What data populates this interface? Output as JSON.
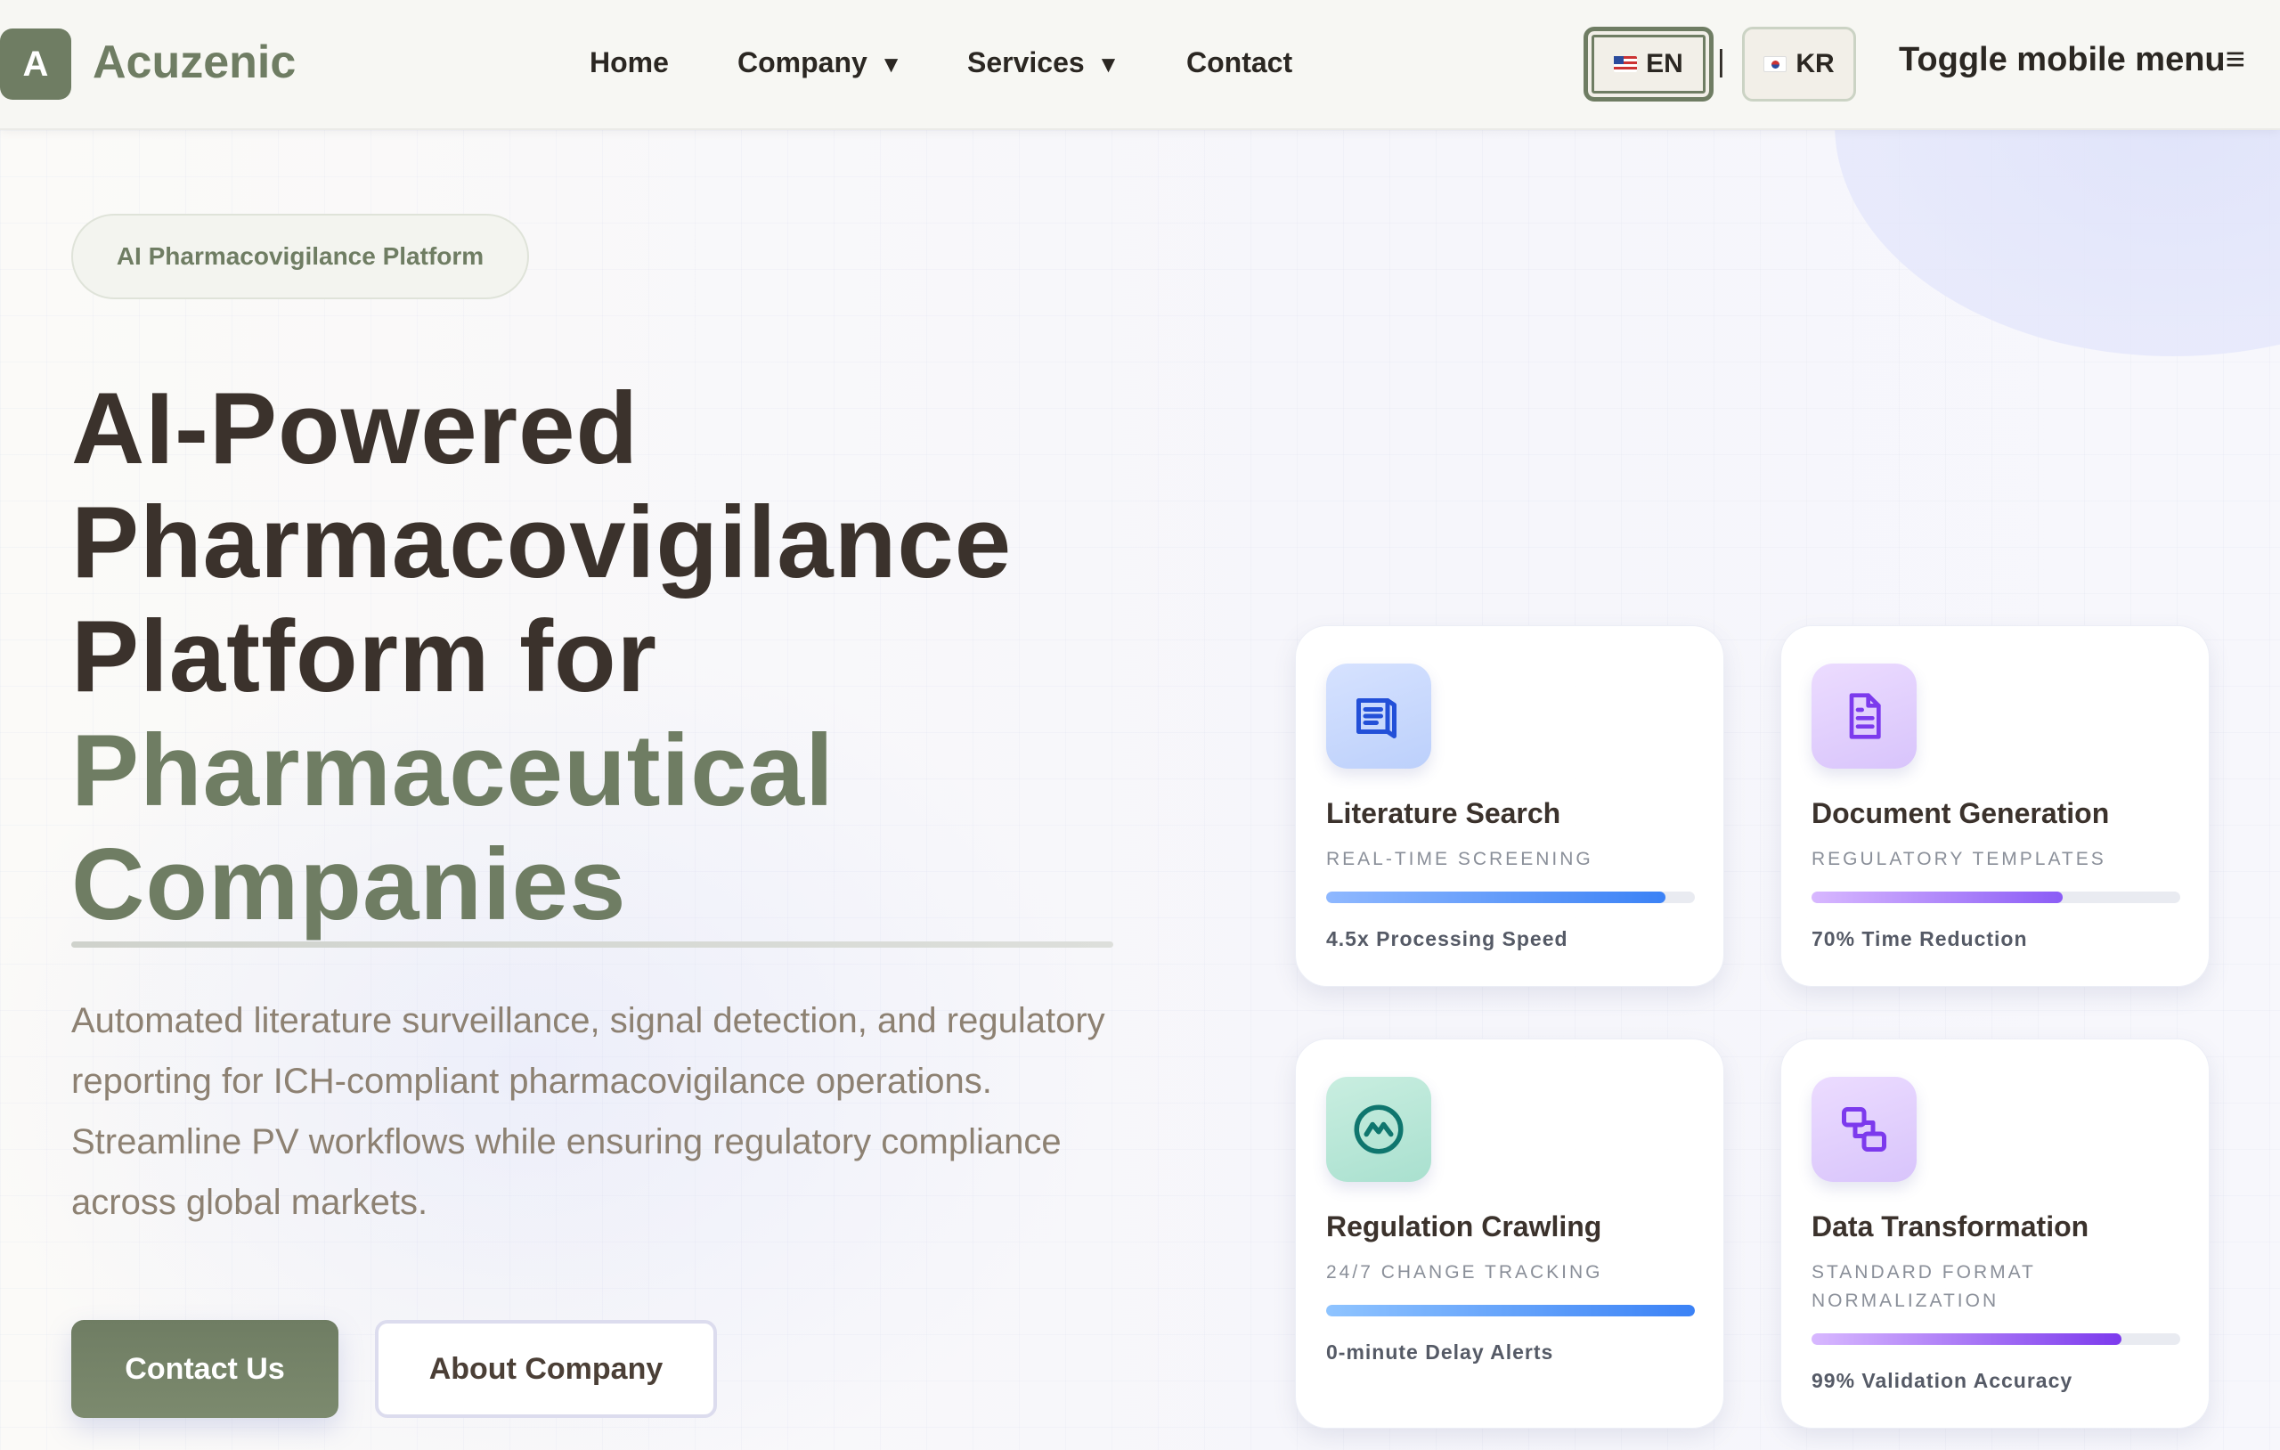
{
  "brand": {
    "logo_letter": "A",
    "name": "Acuzenic"
  },
  "nav": {
    "home": "Home",
    "company": "Company",
    "services": "Services",
    "contact": "Contact",
    "caret": "▼"
  },
  "language": {
    "en": "EN",
    "separator": "|",
    "kr": "KR"
  },
  "mobile_menu": {
    "label": "Toggle mobile menu",
    "icon": "≡"
  },
  "hero": {
    "badge": "AI Pharmacovigilance Platform",
    "headline_line1": "AI-Powered",
    "headline_line2": "Pharmacovigilance",
    "headline_line3": "Platform for",
    "headline_accent1": "Pharmaceutical",
    "headline_accent2": "Companies",
    "description": "Automated literature surveillance, signal detection, and regulatory reporting for ICH-compliant pharmacovigilance operations. Streamline PV workflows while ensuring regulatory compliance across global markets.",
    "primary_button": "Contact Us",
    "secondary_button": "About Company"
  },
  "cards": [
    {
      "title": "Literature Search",
      "subtitle": "REAL-TIME SCREENING",
      "metric": "4.5x Processing Speed",
      "progress": 0.92,
      "icon": "document-list-icon",
      "color": "#3b82f6"
    },
    {
      "title": "Document Generation",
      "subtitle": "REGULATORY TEMPLATES",
      "metric": "70% Time Reduction",
      "progress": 0.68,
      "icon": "file-text-icon",
      "color": "#8b5cf6"
    },
    {
      "title": "Regulation Crawling",
      "subtitle": "24/7 CHANGE TRACKING",
      "metric": "0-minute Delay Alerts",
      "progress": 1.0,
      "icon": "activity-circle-icon",
      "color": "#0f766e"
    },
    {
      "title": "Data Transformation",
      "subtitle": "STANDARD FORMAT NORMALIZATION",
      "metric": "99% Validation Accuracy",
      "progress": 0.84,
      "icon": "transform-icon",
      "color": "#7c3aed"
    }
  ]
}
